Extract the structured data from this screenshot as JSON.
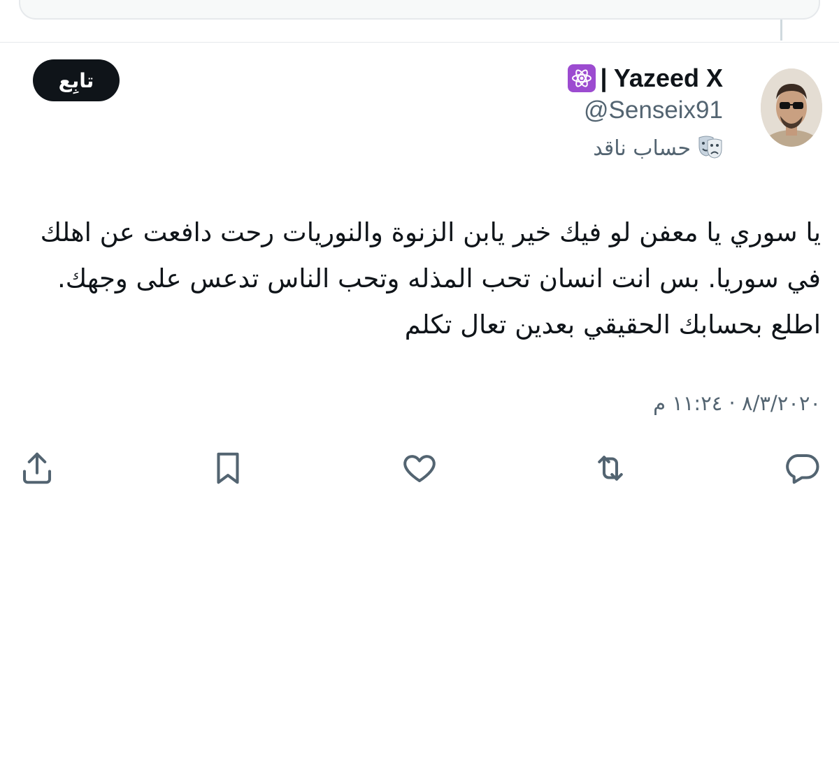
{
  "author": {
    "display_name": "| Yazeed X",
    "handle": "@Senseix91",
    "account_label": "حساب ناقد",
    "emoji_badge": "atom-symbol-emoji",
    "label_emoji": "performing-arts-emoji"
  },
  "follow_label": "تابِع",
  "tweet": {
    "text": "يا سوري يا معفن لو فيك خير يابن الزنوة والنوريات رحت دافعت عن اهلك في سوريا. بس انت انسان تحب المذله وتحب الناس تدعس على وجهك. اطلع بحسابك الحقيقي بعدين تعال تكلم",
    "timestamp": "٨/٣/٢٠٢٠ · ١١:٢٤ م"
  },
  "actions": [
    "reply-icon",
    "retweet-icon",
    "like-icon",
    "bookmark-icon",
    "share-icon"
  ],
  "colors": {
    "text": "#0f1419",
    "secondary": "#536471",
    "button_bg": "#0f1419",
    "badge": "#9c4bd0"
  }
}
